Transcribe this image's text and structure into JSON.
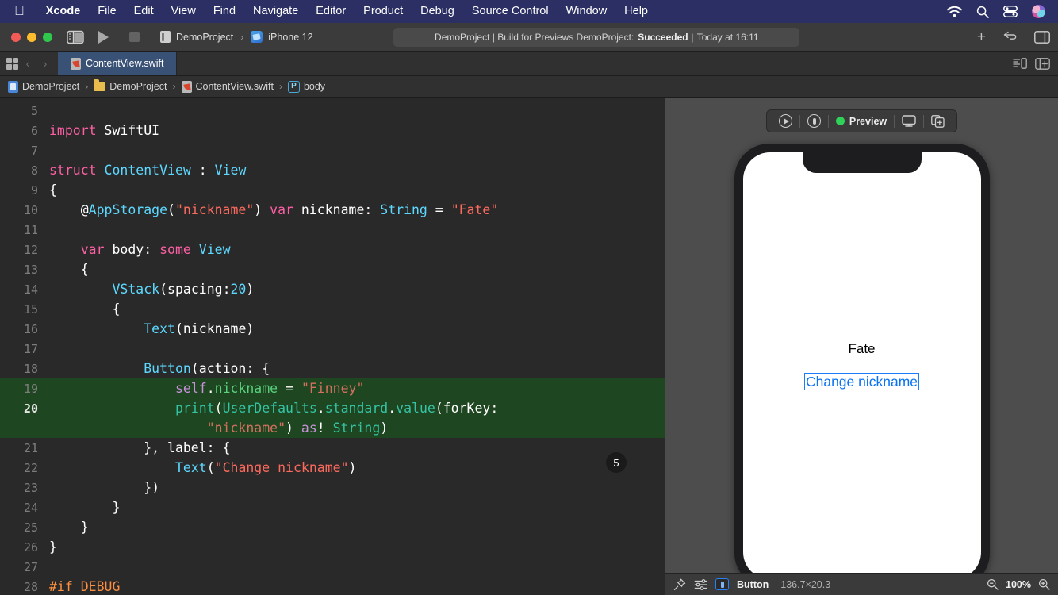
{
  "menubar": {
    "apple_icon": "apple-logo-icon",
    "items": [
      {
        "label": "Xcode",
        "bold": true
      },
      {
        "label": "File",
        "bold": false
      },
      {
        "label": "Edit",
        "bold": false
      },
      {
        "label": "View",
        "bold": false
      },
      {
        "label": "Find",
        "bold": false
      },
      {
        "label": "Navigate",
        "bold": false
      },
      {
        "label": "Editor",
        "bold": false
      },
      {
        "label": "Product",
        "bold": false
      },
      {
        "label": "Debug",
        "bold": false
      },
      {
        "label": "Source Control",
        "bold": false
      },
      {
        "label": "Window",
        "bold": false
      },
      {
        "label": "Help",
        "bold": false
      }
    ],
    "system_icons": [
      "wifi-icon",
      "search-icon",
      "control-center-icon",
      "user-avatar-icon"
    ],
    "background_color": "#2b2f63"
  },
  "toolbar": {
    "window_controls": [
      "close-button",
      "minimize-button",
      "zoom-button"
    ],
    "sidebar_toggle": "sidebar-toggle-icon",
    "run_button": "run-icon",
    "stop_button": "stop-icon",
    "scheme": {
      "project": "DemoProject",
      "chevron": "›",
      "destination": "iPhone 12"
    },
    "status": {
      "prefix": "DemoProject | Build for Previews DemoProject:",
      "result": "Succeeded",
      "separator": "|",
      "time": "Today at 16:11"
    },
    "right_icons": [
      "add-editor-icon",
      "navigate-back-forward-icon",
      "inspector-toggle-icon"
    ],
    "add_label": "+",
    "arrow_label": "⇄"
  },
  "tabbar": {
    "grid_icon": "tab-grid-icon",
    "back_arrow": "‹",
    "forward_arrow": "›",
    "tabs": [
      {
        "label": "ContentView.swift",
        "icon": "swift-file-icon",
        "active": true
      }
    ],
    "right_icons": [
      "minimap-icon",
      "add-assistant-editor-icon"
    ]
  },
  "breadcrumb": {
    "items": [
      {
        "label": "DemoProject",
        "icon": "xcode-project-icon"
      },
      {
        "label": "DemoProject",
        "icon": "folder-icon"
      },
      {
        "label": "ContentView.swift",
        "icon": "swift-file-icon"
      },
      {
        "label": "body",
        "icon": "property-badge-icon"
      }
    ],
    "separator": "›"
  },
  "editor": {
    "badge": "5",
    "lines": [
      {
        "num": "5",
        "tokens": [],
        "highlight": false
      },
      {
        "num": "6",
        "highlight": false,
        "tokens": [
          {
            "t": "import",
            "c": "kw"
          },
          {
            "t": " ",
            "c": "plain"
          },
          {
            "t": "SwiftUI",
            "c": "plain"
          }
        ]
      },
      {
        "num": "7",
        "highlight": false,
        "tokens": []
      },
      {
        "num": "8",
        "highlight": false,
        "tokens": [
          {
            "t": "struct",
            "c": "kw"
          },
          {
            "t": " ",
            "c": "plain"
          },
          {
            "t": "ContentView",
            "c": "type"
          },
          {
            "t": " : ",
            "c": "plain"
          },
          {
            "t": "View",
            "c": "type"
          }
        ]
      },
      {
        "num": "9",
        "highlight": false,
        "tokens": [
          {
            "t": "{",
            "c": "plain"
          }
        ]
      },
      {
        "num": "10",
        "highlight": false,
        "tokens": [
          {
            "t": "    @",
            "c": "plain"
          },
          {
            "t": "AppStorage",
            "c": "attr"
          },
          {
            "t": "(",
            "c": "plain"
          },
          {
            "t": "\"nickname\"",
            "c": "str"
          },
          {
            "t": ") ",
            "c": "plain"
          },
          {
            "t": "var",
            "c": "kw"
          },
          {
            "t": " nickname: ",
            "c": "plain"
          },
          {
            "t": "String",
            "c": "type"
          },
          {
            "t": " = ",
            "c": "plain"
          },
          {
            "t": "\"Fate\"",
            "c": "str"
          }
        ]
      },
      {
        "num": "11",
        "highlight": false,
        "tokens": []
      },
      {
        "num": "12",
        "highlight": false,
        "tokens": [
          {
            "t": "    ",
            "c": "plain"
          },
          {
            "t": "var",
            "c": "kw"
          },
          {
            "t": " body: ",
            "c": "plain"
          },
          {
            "t": "some",
            "c": "kw"
          },
          {
            "t": " ",
            "c": "plain"
          },
          {
            "t": "View",
            "c": "type"
          }
        ]
      },
      {
        "num": "13",
        "highlight": false,
        "tokens": [
          {
            "t": "    {",
            "c": "plain"
          }
        ]
      },
      {
        "num": "14",
        "highlight": false,
        "tokens": [
          {
            "t": "        ",
            "c": "plain"
          },
          {
            "t": "VStack",
            "c": "type"
          },
          {
            "t": "(spacing:",
            "c": "plain"
          },
          {
            "t": "20",
            "c": "type"
          },
          {
            "t": ")",
            "c": "plain"
          }
        ]
      },
      {
        "num": "15",
        "highlight": false,
        "tokens": [
          {
            "t": "        {",
            "c": "plain"
          }
        ]
      },
      {
        "num": "16",
        "highlight": false,
        "tokens": [
          {
            "t": "            ",
            "c": "plain"
          },
          {
            "t": "Text",
            "c": "type"
          },
          {
            "t": "(nickname)",
            "c": "plain"
          }
        ]
      },
      {
        "num": "17",
        "highlight": false,
        "tokens": []
      },
      {
        "num": "18",
        "highlight": false,
        "tokens": [
          {
            "t": "            ",
            "c": "plain"
          },
          {
            "t": "Button",
            "c": "type"
          },
          {
            "t": "(action: {",
            "c": "plain"
          }
        ]
      },
      {
        "num": "19",
        "highlight": true,
        "tokens": [
          {
            "t": "                ",
            "c": "g-plain"
          },
          {
            "t": "self",
            "c": "g-kw"
          },
          {
            "t": ".",
            "c": "g-plain"
          },
          {
            "t": "nickname",
            "c": "g-prop"
          },
          {
            "t": " = ",
            "c": "g-plain"
          },
          {
            "t": "\"Finney\"",
            "c": "g-str"
          }
        ]
      },
      {
        "num": "20",
        "highlight": true,
        "current": true,
        "tokens": [
          {
            "t": "                ",
            "c": "g-plain"
          },
          {
            "t": "print",
            "c": "g-type"
          },
          {
            "t": "(",
            "c": "g-plain"
          },
          {
            "t": "UserDefaults",
            "c": "g-type"
          },
          {
            "t": ".",
            "c": "g-plain"
          },
          {
            "t": "standard",
            "c": "g-type"
          },
          {
            "t": ".",
            "c": "g-plain"
          },
          {
            "t": "value",
            "c": "g-type"
          },
          {
            "t": "(forKey:",
            "c": "g-plain"
          }
        ]
      },
      {
        "num": "",
        "highlight": true,
        "wrapped": true,
        "tokens": [
          {
            "t": "                    ",
            "c": "g-plain"
          },
          {
            "t": "\"nickname\"",
            "c": "g-str"
          },
          {
            "t": ") ",
            "c": "g-plain"
          },
          {
            "t": "as",
            "c": "g-kw"
          },
          {
            "t": "! ",
            "c": "g-plain"
          },
          {
            "t": "String",
            "c": "g-type"
          },
          {
            "t": ")",
            "c": "g-plain"
          }
        ]
      },
      {
        "num": "21",
        "highlight": false,
        "tokens": [
          {
            "t": "            }, label: {",
            "c": "plain"
          }
        ]
      },
      {
        "num": "22",
        "highlight": false,
        "tokens": [
          {
            "t": "                ",
            "c": "plain"
          },
          {
            "t": "Text",
            "c": "type"
          },
          {
            "t": "(",
            "c": "plain"
          },
          {
            "t": "\"Change nickname\"",
            "c": "str"
          },
          {
            "t": ")",
            "c": "plain"
          }
        ]
      },
      {
        "num": "23",
        "highlight": false,
        "tokens": [
          {
            "t": "            })",
            "c": "plain"
          }
        ]
      },
      {
        "num": "24",
        "highlight": false,
        "tokens": [
          {
            "t": "        }",
            "c": "plain"
          }
        ]
      },
      {
        "num": "25",
        "highlight": false,
        "tokens": [
          {
            "t": "    }",
            "c": "plain"
          }
        ]
      },
      {
        "num": "26",
        "highlight": false,
        "tokens": [
          {
            "t": "}",
            "c": "plain"
          }
        ]
      },
      {
        "num": "27",
        "highlight": false,
        "tokens": []
      },
      {
        "num": "28",
        "highlight": false,
        "tokens": [
          {
            "t": "#if DEBUG",
            "c": "prep"
          }
        ]
      }
    ]
  },
  "preview": {
    "toolbar": {
      "play_icon": "play-preview-icon",
      "pause_icon": "pause-preview-icon",
      "status_dot_color": "#30d158",
      "status_label": "Preview",
      "display_icon": "display-device-icon",
      "duplicate_icon": "duplicate-preview-icon"
    },
    "device": "iPhone 12",
    "content": {
      "text_label": "Fate",
      "button_label": "Change nickname",
      "button_color": "#0a73f5"
    }
  },
  "bottombar": {
    "pin_icon": "pin-icon",
    "settings_icon": "preview-settings-icon",
    "element_icon": "button-element-icon",
    "element_name": "Button",
    "element_size": "136.7×20.3",
    "zoom_out_icon": "zoom-out-icon",
    "zoom_level": "100%",
    "zoom_in_icon": "zoom-in-icon"
  }
}
